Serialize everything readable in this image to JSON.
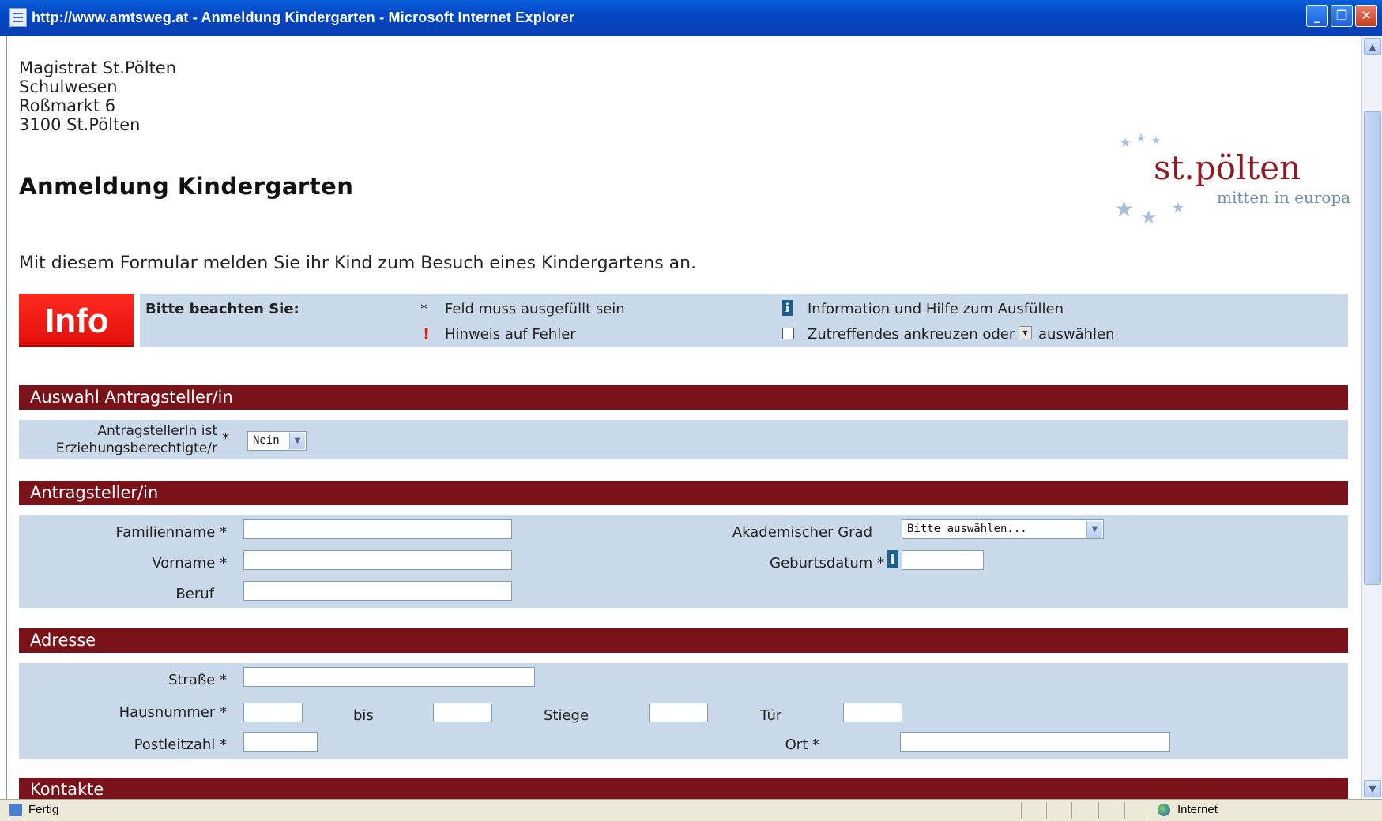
{
  "window": {
    "title": "http://www.amtsweg.at - Anmeldung Kindergarten - Microsoft Internet Explorer",
    "minimize": "_",
    "maximize": "❐",
    "close": "✕"
  },
  "address": {
    "line1": "Magistrat St.Pölten",
    "line2": "Schulwesen",
    "line3": "Roßmarkt 6",
    "line4": "3100 St.Pölten"
  },
  "page_title": "Anmeldung Kindergarten",
  "logo": {
    "name": "st.pölten",
    "tagline": "mitten in europa"
  },
  "intro": "Mit diesem Formular melden Sie ihr Kind zum Besuch eines Kindergartens an.",
  "info": {
    "button": "Info",
    "title": "Bitte beachten Sie:",
    "star_symbol": "*",
    "required": "Feld muss ausgefüllt sein",
    "error_symbol": "!",
    "error": "Hinweis auf Fehler",
    "info_symbol": "i",
    "help": "Information und Hilfe zum Ausfüllen",
    "check_prefix": "Zutreffendes ankreuzen oder",
    "check_suffix": "auswählen"
  },
  "sections": {
    "auswahl": {
      "title": "Auswahl Antragsteller/in",
      "label_line1": "AntragstellerIn ist",
      "label_line2": "Erziehungsberechtigte/r",
      "star": "*",
      "select_value": "Nein"
    },
    "antragsteller": {
      "title": "Antragsteller/in",
      "familienname": "Familienname *",
      "vorname": "Vorname *",
      "beruf": "Beruf",
      "akad_grad": "Akademischer Grad",
      "akad_value": "Bitte auswählen...",
      "geburtsdatum": "Geburtsdatum *"
    },
    "adresse": {
      "title": "Adresse",
      "strasse": "Straße *",
      "hausnummer": "Hausnummer *",
      "bis": "bis",
      "stiege": "Stiege",
      "tuer": "Tür",
      "plz": "Postleitzahl *",
      "ort": "Ort *"
    },
    "kontakte": {
      "title": "Kontakte"
    }
  },
  "status": {
    "text": "Fertig",
    "zone": "Internet"
  },
  "icons": {
    "scroll_up": "▲",
    "scroll_down": "▼",
    "dropdown": "▼"
  },
  "colors": {
    "section_header": "#7a1319",
    "panel": "#c9d9ea",
    "info_button": "#e8140c",
    "titlebar": "#0347c6"
  }
}
